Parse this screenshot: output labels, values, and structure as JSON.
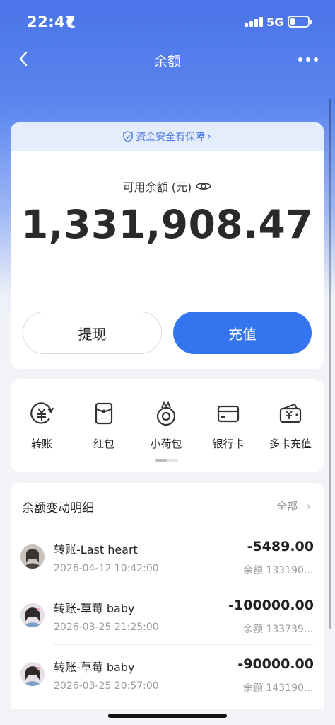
{
  "status_bar": {
    "time": "22:47",
    "network": "5G"
  },
  "nav": {
    "title": "余额"
  },
  "balance": {
    "secure_text": "资金安全有保障",
    "secure_chevron": "›",
    "label": "可用余额 (元)",
    "amount": "1,331,908.47",
    "withdraw_label": "提现",
    "recharge_label": "充值"
  },
  "shortcuts": [
    {
      "label": "转账",
      "icon": "transfer-icon"
    },
    {
      "label": "红包",
      "icon": "red-packet-icon"
    },
    {
      "label": "小荷包",
      "icon": "purse-icon"
    },
    {
      "label": "银行卡",
      "icon": "bank-card-icon"
    },
    {
      "label": "多卡充值",
      "icon": "multi-card-recharge-icon"
    }
  ],
  "transactions": {
    "title": "余额变动明细",
    "all_label": "全部",
    "all_chevron": "›",
    "items": [
      {
        "name": "转账-Last heart",
        "date": "2026-04-12 10:42:00",
        "amount": "-5489.00",
        "balance": "余额 133190..."
      },
      {
        "name": "转账-草莓 baby",
        "date": "2026-03-25 21:25:00",
        "amount": "-100000.00",
        "balance": "余额 133739..."
      },
      {
        "name": "转账-草莓 baby",
        "date": "2026-03-25 20:57:00",
        "amount": "-90000.00",
        "balance": "余额 143190..."
      }
    ]
  },
  "colors": {
    "primary": "#3574ef",
    "header": "#4a74e8",
    "secure_bg": "#e4edfb"
  }
}
